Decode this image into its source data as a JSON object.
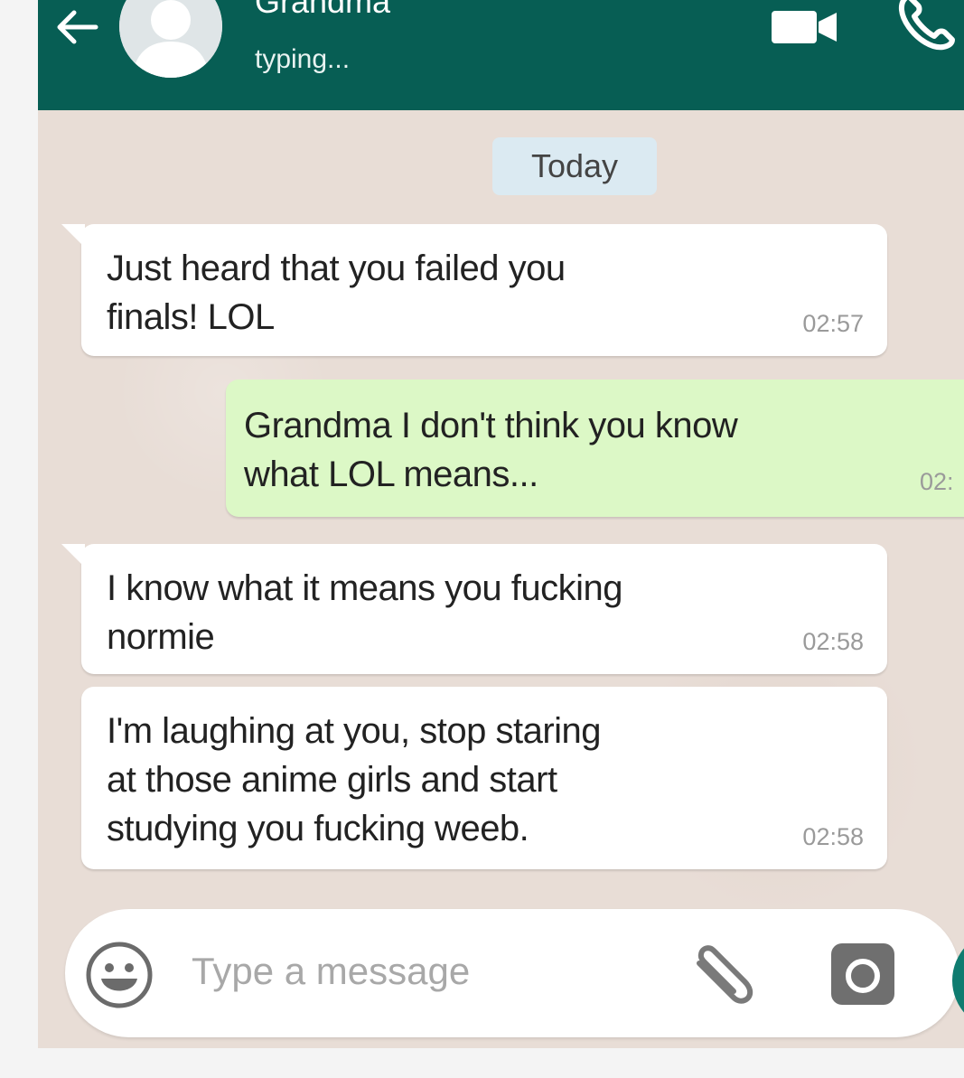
{
  "header": {
    "contact_name": "Grandma",
    "contact_status": "typing...",
    "back_icon": "arrow-left-icon",
    "avatar_icon": "default-avatar-icon",
    "video_icon": "video-camera-icon",
    "call_icon": "phone-icon",
    "background_color": "#075e54"
  },
  "chat": {
    "date_divider": "Today",
    "messages": [
      {
        "direction": "incoming",
        "lines": [
          "Just heard that you failed you",
          "finals! LOL"
        ],
        "time": "02:57"
      },
      {
        "direction": "outgoing",
        "lines": [
          "Grandma I don't think you know",
          "what LOL means..."
        ],
        "time": "02:"
      },
      {
        "direction": "incoming",
        "lines": [
          "I know what it means you fucking",
          "normie"
        ],
        "time": "02:58"
      },
      {
        "direction": "incoming",
        "lines": [
          "I'm laughing at you, stop staring",
          "at those anime girls and start",
          "studying you fucking weeb."
        ],
        "time": "02:58"
      }
    ],
    "incoming_bubble_color": "#ffffff",
    "outgoing_bubble_color": "#dcf8c6"
  },
  "composer": {
    "placeholder": "Type a message",
    "value": "",
    "emoji_icon": "smiley-icon",
    "attach_icon": "paperclip-icon",
    "camera_icon": "camera-icon",
    "mic_icon": "microphone-icon",
    "mic_button_color": "#0f7c70"
  }
}
